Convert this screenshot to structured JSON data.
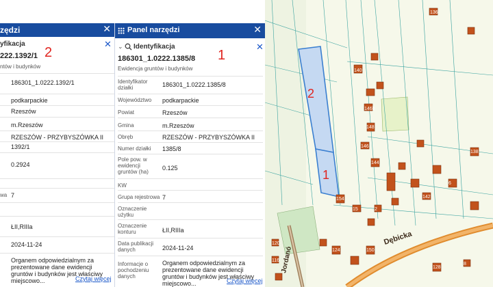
{
  "back_panel": {
    "title": "zędzi",
    "close": "✕",
    "subtitle": "yfikacja",
    "subtitle_close": "✕",
    "id": "222.1392/1",
    "source": "ntów i budynków",
    "marker": "2",
    "rows": [
      {
        "label": "",
        "value": "186301_1.0222.1392/1"
      },
      {
        "label": "",
        "value": "podkarpackie"
      },
      {
        "label": "",
        "value": "Rzeszów"
      },
      {
        "label": "",
        "value": "m.Rzeszów"
      },
      {
        "label": "",
        "value": "RZESZÓW - PRZYBYSZÓWKA II"
      },
      {
        "label": "",
        "value": "1392/1"
      },
      {
        "label": "",
        "value": "0.2924"
      },
      {
        "label": "wa",
        "value": "7"
      },
      {
        "label": "",
        "value": "ŁII,RIIIa"
      },
      {
        "label": "",
        "value": "2024-11-24"
      },
      {
        "label": "",
        "value": "Organem odpowiedzialnym za prezentowane dane ewidencji gruntów i budynków jest właściwy miejscowo..."
      }
    ],
    "more": "Czytaj więcej"
  },
  "front_panel": {
    "title": "Panel narzędzi",
    "close": "✕",
    "section": "Identyfikacja",
    "section_close": "✕",
    "marker": "1",
    "id": "186301_1.0222.1385/8",
    "source": "Ewidencja gruntów i budynków",
    "rows": [
      {
        "label": "Identyfikator działki",
        "value": "186301_1.0222.1385/8"
      },
      {
        "label": "Województwo",
        "value": "podkarpackie"
      },
      {
        "label": "Powiat",
        "value": "Rzeszów"
      },
      {
        "label": "Gmina",
        "value": "m.Rzeszów"
      },
      {
        "label": "Obręb",
        "value": "RZESZÓW - PRZYBYSZÓWKA II"
      },
      {
        "label": "Numer działki",
        "value": "1385/8"
      },
      {
        "label": "Pole pow. w ewidencji gruntów (ha)",
        "value": "0.125"
      },
      {
        "label": "KW",
        "value": ""
      },
      {
        "label": "Grupa rejestrowa",
        "value": "7"
      },
      {
        "label": "Oznaczenie użytku",
        "value": ""
      },
      {
        "label": "Oznaczenie konturu",
        "value": "ŁII,RIIIa"
      },
      {
        "label": "Data publikacji danych",
        "value": "2024-11-24"
      },
      {
        "label": "Informacje o pochodzeniu danych",
        "value": "Organem odpowiedzialnym za prezentowane dane ewidencji gruntów i budynków jest właściwy miejscowo..."
      }
    ],
    "more": "Czytaj więcej"
  },
  "map": {
    "parcel_labels": [
      "2",
      "1"
    ],
    "street_labels": [
      "Dębicka",
      "Jordanó"
    ],
    "building_numbers": [
      "136",
      "140",
      "146b",
      "144",
      "138",
      "142",
      "148",
      "146",
      "154",
      "150",
      "116",
      "120",
      "124",
      "128",
      "15",
      "2",
      "8",
      "6"
    ]
  },
  "colors": {
    "header": "#184c9f",
    "marker": "#e0241f",
    "link": "#1a57c9",
    "parcel_fill": "#c5d9f2",
    "parcel_stroke": "#3a7fd0",
    "building": "#c2521c",
    "road": "#e08c2e"
  }
}
